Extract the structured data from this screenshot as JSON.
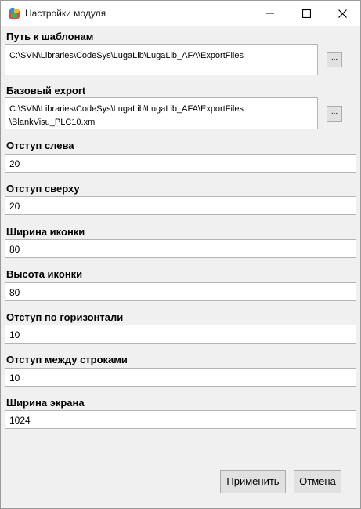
{
  "window": {
    "title": "Настройки модуля",
    "icon": "app-logo-icon"
  },
  "titlebar_buttons": [
    "minimize-icon",
    "maximize-icon",
    "close-icon"
  ],
  "fields": {
    "template_path": {
      "label": "Путь к шаблонам",
      "value": "C:\\SVN\\Libraries\\CodeSys\\LugaLib\\LugaLib_AFA\\ExportFiles",
      "browse_label": "..."
    },
    "base_export": {
      "label": "Базовый export",
      "value_line1": "C:\\SVN\\Libraries\\CodeSys\\LugaLib\\LugaLib_AFA\\ExportFiles",
      "value_line2": "\\BlankVisu_PLC10.xml",
      "browse_label": "..."
    },
    "left_offset": {
      "label": "Отступ слева",
      "value": "20"
    },
    "top_offset": {
      "label": "Отступ сверху",
      "value": "20"
    },
    "icon_width": {
      "label": "Ширина иконки",
      "value": "80"
    },
    "icon_height": {
      "label": "Высота иконки",
      "value": "80"
    },
    "horizontal_offset": {
      "label": "Отступ по горизонтали",
      "value": "10"
    },
    "row_spacing": {
      "label": "Отступ между строками",
      "value": "10"
    },
    "screen_width": {
      "label": "Ширина экрана",
      "value": "1024"
    }
  },
  "buttons": {
    "apply": "Применить",
    "cancel": "Отмена"
  }
}
